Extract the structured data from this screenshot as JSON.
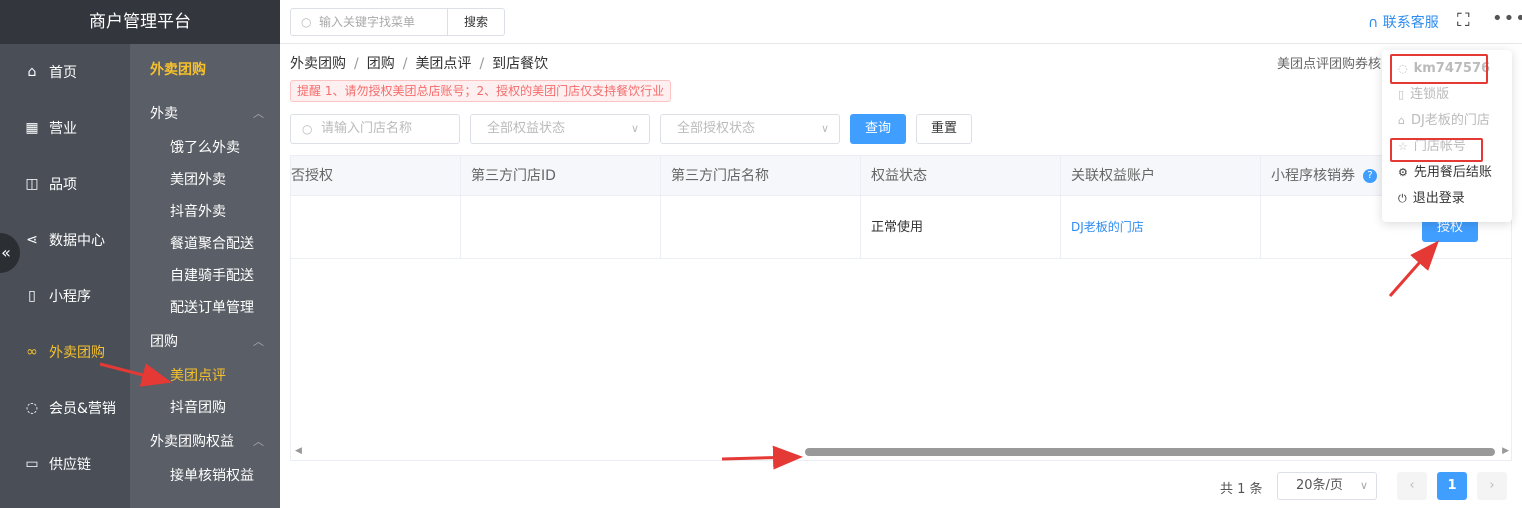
{
  "brand": "商户管理平台",
  "nav": [
    {
      "label": "首页",
      "icon": "home-icon",
      "glyph": "⌂"
    },
    {
      "label": "营业",
      "icon": "calendar-icon",
      "glyph": "▦"
    },
    {
      "label": "品项",
      "icon": "bag-icon",
      "glyph": "◫"
    },
    {
      "label": "数据中心",
      "icon": "share-icon",
      "glyph": "⋖"
    },
    {
      "label": "小程序",
      "icon": "phone-icon",
      "glyph": "▯"
    },
    {
      "label": "外卖团购",
      "icon": "bicycle-icon",
      "glyph": "∞",
      "active": true
    },
    {
      "label": "会员&营销",
      "icon": "user-icon",
      "glyph": "◌"
    },
    {
      "label": "供应链",
      "icon": "truck-icon",
      "glyph": "▭"
    }
  ],
  "collapse_glyph": "«",
  "subnav": {
    "title": "外卖团购",
    "groups": [
      {
        "label": "外卖",
        "items": [
          "饿了么外卖",
          "美团外卖",
          "抖音外卖",
          "餐道聚合配送",
          "自建骑手配送",
          "配送订单管理"
        ]
      },
      {
        "label": "团购",
        "items": [
          "美团点评",
          "抖音团购"
        ]
      },
      {
        "label": "外卖团购权益",
        "items": [
          "接单核销权益"
        ]
      }
    ],
    "active_item": "美团点评"
  },
  "topbar": {
    "search_placeholder": "输入关键字找菜单",
    "search_button": "搜索",
    "service": "联系客服",
    "fullscreen_glyph": "⛶",
    "more_glyph": "•••"
  },
  "breadcrumb": [
    "外卖团购",
    "团购",
    "美团点评",
    "到店餐饮"
  ],
  "breadcrumb_sep": "/",
  "top_right_text": "美团点评团购券核",
  "warning": "提醒 1、请勿授权美团总店账号；2、授权的美团门店仅支持餐饮行业",
  "filters": {
    "store_placeholder": "请输入门店名称",
    "rights_status": "全部权益状态",
    "auth_status": "全部授权状态",
    "query": "查询",
    "reset": "重置"
  },
  "table": {
    "columns": [
      "否授权",
      "第三方门店ID",
      "第三方门店名称",
      "权益状态",
      "关联权益账户",
      "小程序核销券"
    ],
    "help_glyph": "?",
    "rows": [
      {
        "c0": "",
        "c1": "",
        "c2": "",
        "c3": "正常使用",
        "c4": "DJ老板的门店",
        "c5": "",
        "action": "授权"
      }
    ]
  },
  "pager": {
    "total": "共 1 条",
    "page_size": "20条/页",
    "current": "1",
    "prev_glyph": "‹",
    "next_glyph": "›"
  },
  "dropdown": {
    "account": "km747576",
    "items": [
      {
        "label": "连锁版",
        "icon": "bookmark-icon",
        "glyph": "▯",
        "dark": false
      },
      {
        "label": "DJ老板的门店",
        "icon": "home-icon",
        "glyph": "⌂",
        "dark": false
      },
      {
        "label": "门店帐号",
        "icon": "star-icon",
        "glyph": "☆",
        "dark": false
      },
      {
        "label": "先用餐后结账",
        "icon": "gear-icon",
        "glyph": "⚙",
        "dark": true
      },
      {
        "label": "退出登录",
        "icon": "power-icon",
        "glyph": "⏻",
        "dark": true
      }
    ]
  }
}
